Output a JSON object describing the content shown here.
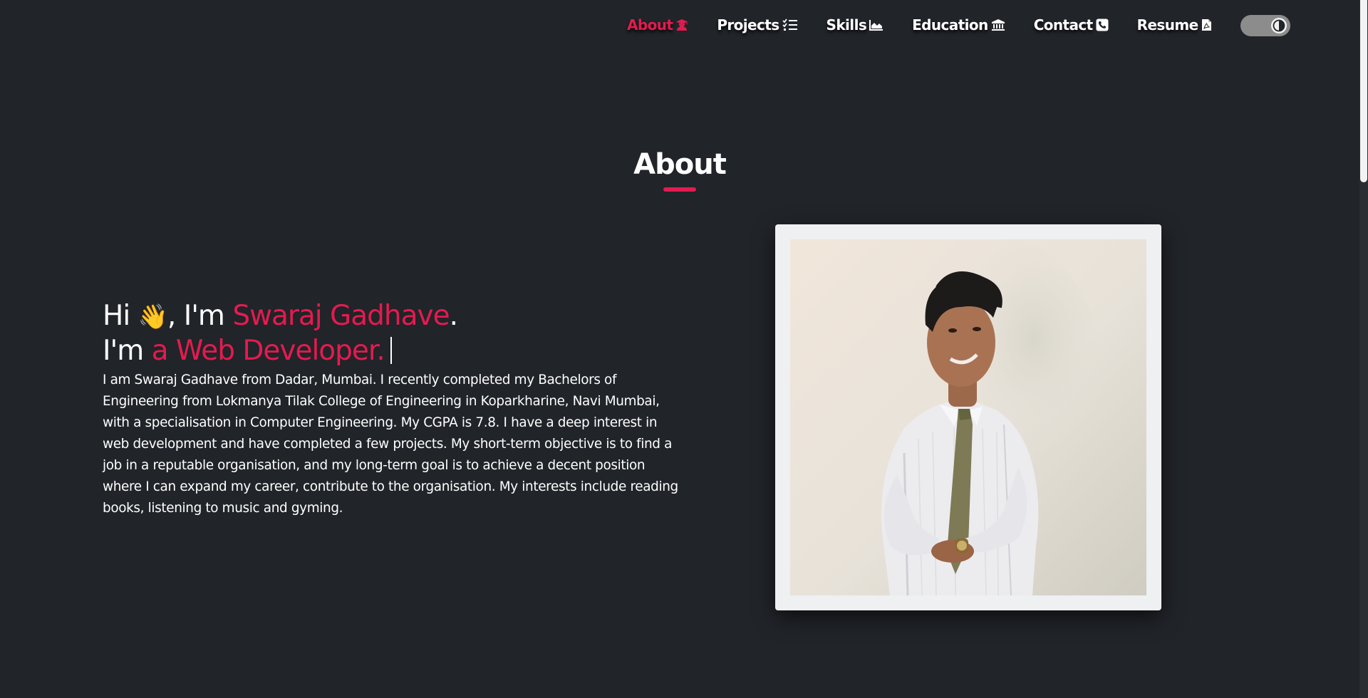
{
  "nav": {
    "items": [
      {
        "label": "About",
        "icon": "user-graduate-icon",
        "active": true
      },
      {
        "label": "Projects",
        "icon": "list-check-icon",
        "active": false
      },
      {
        "label": "Skills",
        "icon": "area-chart-icon",
        "active": false
      },
      {
        "label": "Education",
        "icon": "university-icon",
        "active": false
      },
      {
        "label": "Contact",
        "icon": "phone-square-icon",
        "active": false
      },
      {
        "label": "Resume",
        "icon": "file-pdf-icon",
        "active": false
      }
    ],
    "theme_toggle_icon": "contrast-icon"
  },
  "about": {
    "title": "About",
    "greeting_prefix": "Hi ",
    "wave_emoji": "👋",
    "greeting_mid": ", I'm ",
    "name": "Swaraj Gadhave",
    "greeting_end": ".",
    "role_prefix": "I'm ",
    "role": "a Web Developer.",
    "bio": "I am Swaraj Gadhave from Dadar, Mumbai. I recently completed my Bachelors of Engineering from Lokmanya Tilak College of Engineering in Koparkharine, Navi Mumbai, with a specialisation in Computer Engineering. My CGPA is 7.8. I have a deep interest in web development and have completed a few projects. My short-term objective is to find a job in a reputable organisation, and my long-term goal is to achieve a decent position where I can expand my career, contribute to the organisation. My interests include reading books, listening to music and gyming."
  },
  "colors": {
    "background": "#212429",
    "accent": "#e31b4f",
    "text": "#ffffff",
    "photo_frame": "#eef0f2"
  }
}
